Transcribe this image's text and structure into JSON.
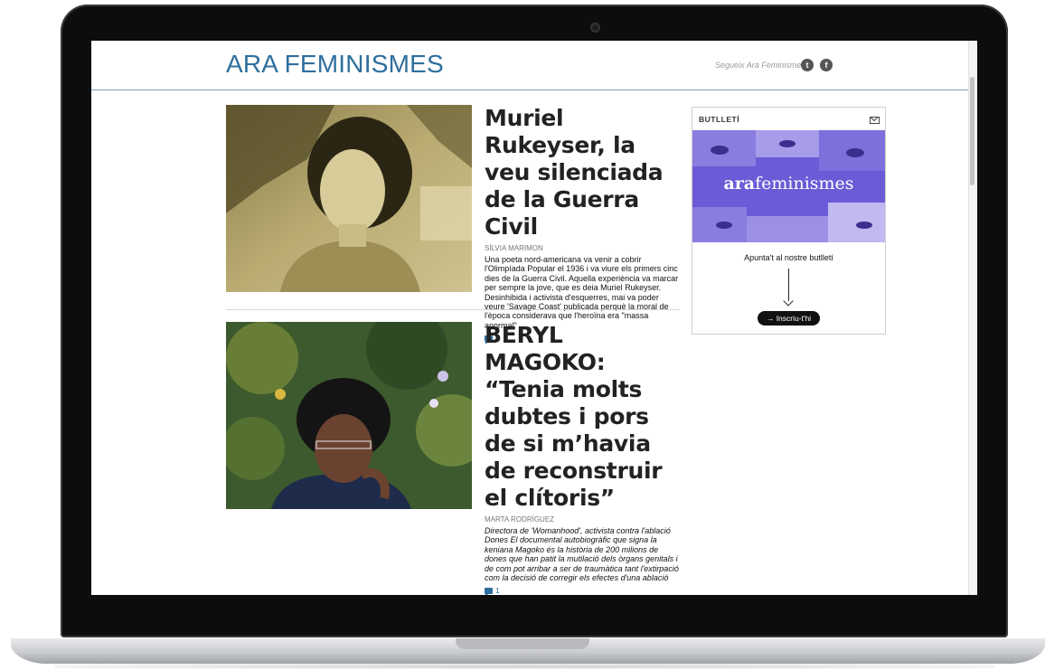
{
  "site": {
    "title": "ARA FEMINISMES",
    "follow_text": "Segueix Ara Feminismes",
    "social": [
      {
        "icon": "twitter-icon",
        "glyph": "t"
      },
      {
        "icon": "facebook-icon",
        "glyph": "f"
      }
    ]
  },
  "articles": [
    {
      "headline": "Muriel Rukeyser, la veu silenciada de la Guerra Civil",
      "byline": "SÍLVIA MARIMON",
      "summary": "Una poeta nord-americana va venir a cobrir l'Olimpíada Popular el 1936 i va viure els primers cinc dies de la Guerra Civil. Aquella experiència va marcar per sempre la jove, que es deia Muriel Rukeyser. Desinhibida i activista d'esquerres, mai va poder veure 'Savage Coast' publicada perquè la moral de l'època considerava que l'heroïna era \"massa anormal\"",
      "comments": "1",
      "image_icon": "portrait-photo"
    },
    {
      "headline": "BERYL MAGOKO: “Tenia molts dubtes i pors de si m’havia de reconstruir el clítoris”",
      "byline": "MARTA RODRÍGUEZ",
      "summary": "Directora de 'Womanhood', activista contra l'ablació Dones El documental autobiogràfic que signa la keniana Magoko és la història de 200 milions de dones que han patit la mutilació dels òrgans genitals i de com pot arribar a ser de traumàtica tant l'extirpació com la decisió de corregir els efectes d'una ablació",
      "comments": "1",
      "image_icon": "portrait-photo"
    }
  ],
  "newsletter": {
    "label": "BUTLLETÍ",
    "brand_bold": "ara",
    "brand_regular": "feminismes",
    "signup_text": "Apunta't al nostre butlletí",
    "button_label": "→ Inscriu-t'hi"
  },
  "colors": {
    "accent": "#2e6f9e",
    "banner_purple": "#6b5bd6"
  }
}
